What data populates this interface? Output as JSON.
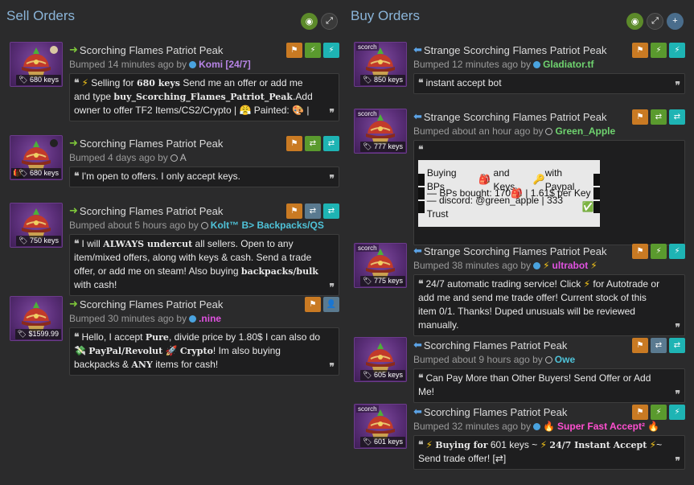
{
  "sell": {
    "title": "Sell Orders",
    "listings": [
      {
        "price": "680 keys",
        "title": "Scorching Flames Patriot Peak",
        "bumped": "Bumped 14 minutes ago by",
        "user": "Komi [24/7]",
        "msg_a": "Selling for",
        "msg_b": "680 keys",
        "msg_c": "Send me an offer or add me and type",
        "msg_d": "buy_Scorching_Flames_Patriot_Peak",
        "msg_e": ".Add owner to offer TF2 Items/CS2/Crypto |",
        "msg_f": "Painted:",
        "msg_g": "|"
      },
      {
        "price": "680 keys",
        "title": "Scorching Flames Patriot Peak",
        "bumped": "Bumped 4 days ago by",
        "user": "A",
        "msg": "I'm open to offers. I only accept keys."
      },
      {
        "price": "750 keys",
        "title": "Scorching Flames Patriot Peak",
        "bumped": "Bumped about 5 hours ago by",
        "user": "Kolt™ B> Backpacks/QS",
        "msg_a": "I will",
        "msg_b": "ALWAYS undercut",
        "msg_c": "all sellers. Open to any item/mixed offers, along with keys & cash. Send a trade offer, or add me on steam! Also buying",
        "msg_d": "backpacks/bulk",
        "msg_e": "with cash!"
      },
      {
        "price": "$1599.99",
        "title": "Scorching Flames Patriot Peak",
        "bumped": "Bumped 30 minutes ago by",
        "user": ".nine",
        "msg_a": "Hello, I accept",
        "msg_b": "Pure",
        "msg_c": ", divide price by 1.80$ I can also do",
        "msg_d": "PayPal/Revolut",
        "msg_e": "Crypto",
        "msg_f": "! Im also buying backpacks &",
        "msg_g": "ANY",
        "msg_h": "items for cash!"
      }
    ]
  },
  "buy": {
    "title": "Buy Orders",
    "listings": [
      {
        "tag": "scorch",
        "price": "850 keys",
        "title": "Strange Scorching Flames Patriot Peak",
        "bumped": "Bumped 12 minutes ago by",
        "user": "Gladiator.tf",
        "msg": "instant accept bot"
      },
      {
        "tag": "scorch",
        "price": "777 keys",
        "title": "Strange Scorching Flames Patriot Peak",
        "bumped": "Bumped about an hour ago by",
        "user": "Green_Apple",
        "line1_a": "Buying BPs",
        "line1_b": "and Keys",
        "line1_c": "with Paypal",
        "line2": "— BPs bought: 170",
        "line2_b": "| 1.61$ per Key",
        "line3": "— discord: @green_apple | 333 Trust"
      },
      {
        "tag": "scorch",
        "price": "775 keys",
        "title": "Strange Scorching Flames Patriot Peak",
        "bumped": "Bumped 38 minutes ago by",
        "user": "ultrabot",
        "msg_a": "24/7 automatic trading service! Click",
        "msg_b": "for Autotrade or add me and send me trade offer! Current stock of this item 0/1. Thanks! Duped unusuals will be reviewed manually."
      },
      {
        "price": "605 keys",
        "title": "Scorching Flames Patriot Peak",
        "bumped": "Bumped about 9 hours ago by",
        "user": "Owe",
        "msg": "Can Pay More than Other Buyers! Send Offer or Add Me!"
      },
      {
        "tag": "scorch",
        "price": "601 keys",
        "title": "Scorching Flames Patriot Peak",
        "bumped": "Bumped 32 minutes ago by",
        "user": "Super Fast Accept²",
        "msg_a": "Buying for",
        "msg_b": "601 keys ~",
        "msg_c": "24/7 Instant Accept",
        "msg_d": "~",
        "msg_e": "Send trade offer! [⇄]"
      }
    ]
  },
  "colors": {
    "background": "#2b2b2c",
    "title": "#8ab4d8",
    "sell_arrow": "#7dc63a",
    "buy_arrow": "#5ca4e8",
    "badge_orange": "#c97a23",
    "badge_green": "#5a9a2e",
    "badge_teal": "#1eb4b4"
  }
}
